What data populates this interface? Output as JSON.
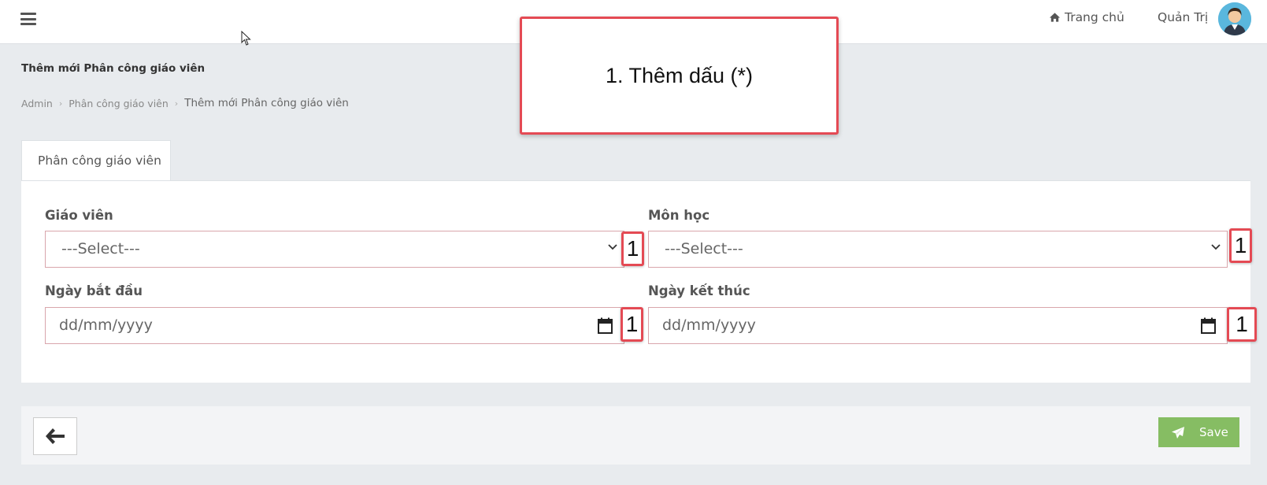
{
  "header": {
    "home_label": "Trang chủ",
    "user_name": "Quản Trị"
  },
  "page": {
    "title": "Thêm mới Phân công giáo viên",
    "breadcrumb": [
      "Admin",
      "Phân công giáo viên",
      "Thêm mới Phân công giáo viên"
    ]
  },
  "annotation": {
    "note": "1. Thêm dấu (*)",
    "badge": "1"
  },
  "tab": {
    "label": "Phân công giáo viên"
  },
  "form": {
    "teacher": {
      "label": "Giáo viên",
      "value": "---Select---"
    },
    "subject": {
      "label": "Môn học",
      "value": "---Select---"
    },
    "start_date": {
      "label": "Ngày bắt đầu",
      "placeholder": "dd/mm/yyyy"
    },
    "end_date": {
      "label": "Ngày kết thúc",
      "placeholder": "dd/mm/yyyy"
    }
  },
  "footer": {
    "save_label": "Save"
  },
  "colors": {
    "accent_red": "#e44a54",
    "save_green": "#86bd63",
    "field_border": "#d9a6ac"
  }
}
